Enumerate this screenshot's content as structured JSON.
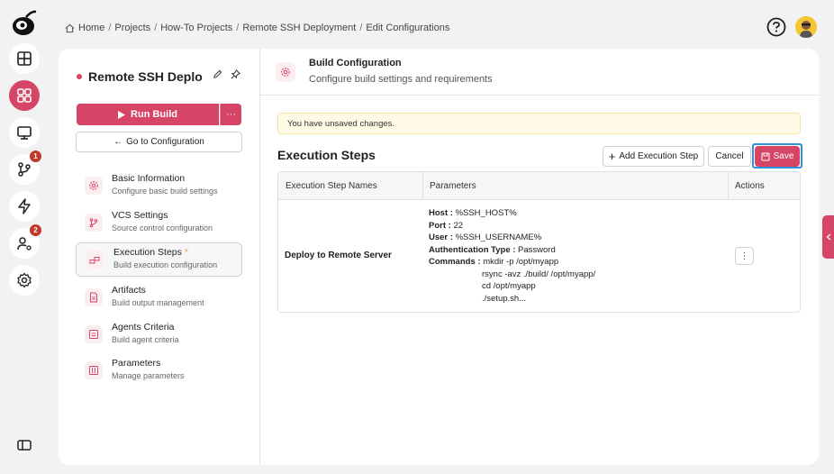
{
  "breadcrumb": {
    "home": "Home",
    "items": [
      "Projects",
      "How-To Projects",
      "Remote SSH Deployment",
      "Edit Configurations"
    ]
  },
  "rail": {
    "items": [
      {
        "icon": "dashboard-icon"
      },
      {
        "icon": "apps-grid-icon",
        "active": true
      },
      {
        "icon": "monitor-icon"
      },
      {
        "icon": "branch-icon",
        "badge": "1"
      },
      {
        "icon": "lightning-icon"
      },
      {
        "icon": "users-settings-icon",
        "badge": "2"
      },
      {
        "icon": "gear-icon"
      }
    ]
  },
  "left_panel": {
    "title": "Remote SSH Deployment",
    "run_label": "Run Build",
    "more_label": "···",
    "goto_label": "Go to Configuration",
    "nav": [
      {
        "label": "Basic Information",
        "sub": "Configure basic build settings",
        "icon": "gear-icon"
      },
      {
        "label": "VCS Settings",
        "sub": "Source control configuration",
        "icon": "branch-icon"
      },
      {
        "label": "Execution Steps",
        "required": "*",
        "sub": "Build execution configuration",
        "icon": "steps-icon",
        "active": true
      },
      {
        "label": "Artifacts",
        "sub": "Build output management",
        "icon": "file-icon"
      },
      {
        "label": "Agents Criteria",
        "sub": "Build agent criteria",
        "icon": "agent-icon"
      },
      {
        "label": "Parameters",
        "sub": "Manage parameters",
        "icon": "sliders-icon"
      }
    ]
  },
  "right_panel": {
    "title": "Build Configuration",
    "subtitle": "Configure build settings and requirements",
    "alert": "You have unsaved changes.",
    "section_title": "Execution Steps",
    "add_label": "Add Execution Step",
    "cancel_label": "Cancel",
    "save_label": "Save",
    "table": {
      "headers": [
        "Execution Step Names",
        "Parameters",
        "Actions"
      ],
      "row": {
        "name": "Deploy to Remote Server",
        "host_key": "Host :",
        "host_val": "%SSH_HOST%",
        "port_key": "Port :",
        "port_val": "22",
        "user_key": "User :",
        "user_val": "%SSH_USERNAME%",
        "auth_key": "Authentication Type :",
        "auth_val": "Password",
        "cmd_key": "Commands :",
        "commands": [
          "mkdir -p /opt/myapp",
          "rsync -avz ./build/ /opt/myapp/",
          "cd /opt/myapp",
          "./setup.sh..."
        ],
        "action_label": "⋮"
      }
    }
  },
  "colors": {
    "accent": "#d64565",
    "focus": "#2f8fd8",
    "alert_bg": "#fffbe6"
  }
}
